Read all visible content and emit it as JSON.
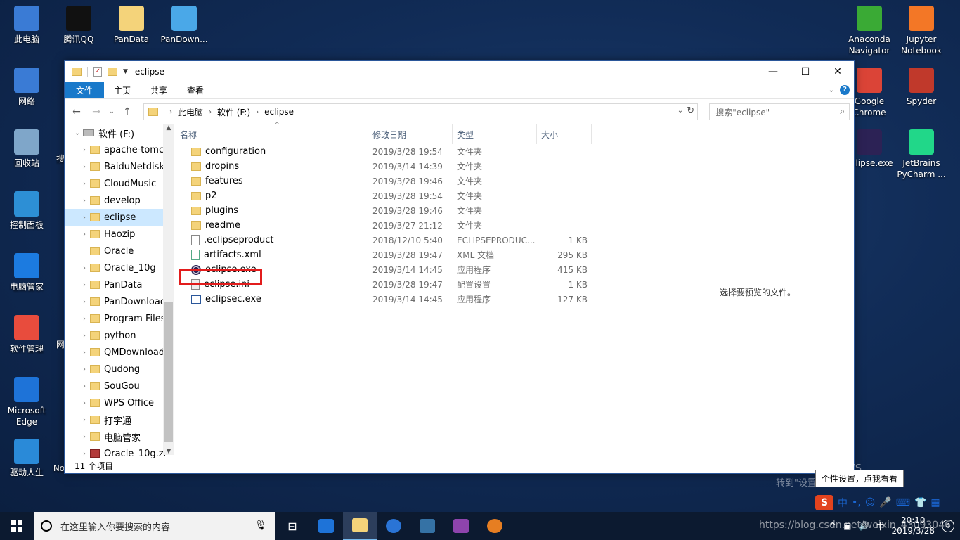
{
  "desktop": {
    "icons_left": [
      {
        "label": "此电脑",
        "icon": "computer-icon",
        "color": "#3a7bd5"
      },
      {
        "label": "网络",
        "icon": "network-icon",
        "color": "#3a7bd5"
      },
      {
        "label": "回收站",
        "icon": "recycle-bin-icon",
        "color": "#7fa6c9"
      },
      {
        "label": "控制面板",
        "icon": "control-panel-icon",
        "color": "#2d8fd5"
      },
      {
        "label": "电脑管家",
        "icon": "pc-manager-icon",
        "color": "#1c7be0"
      },
      {
        "label": "软件管理",
        "icon": "software-manager-icon",
        "color": "#e84c3d"
      },
      {
        "label": "Microsoft Edge",
        "icon": "edge-icon",
        "color": "#1e73d8"
      },
      {
        "label": "驱动人生",
        "icon": "driver-icon",
        "color": "#2a8ad8"
      }
    ],
    "icons_top": [
      {
        "label": "腾讯QQ",
        "icon": "qq-icon",
        "color": "#111111"
      },
      {
        "label": "PanData",
        "icon": "folder-icon",
        "color": "#f4d37a"
      },
      {
        "label": "PanDown...",
        "icon": "cloud-icon",
        "color": "#4aa8e8"
      }
    ],
    "icons_right": [
      {
        "label": "Anaconda Navigator",
        "icon": "anaconda-icon",
        "color": "#3aaa35"
      },
      {
        "label": "Jupyter Notebook",
        "icon": "jupyter-icon",
        "color": "#f37726"
      },
      {
        "label": "Google Chrome",
        "icon": "chrome-icon",
        "color": "#db4437"
      },
      {
        "label": "Spyder",
        "icon": "spyder-icon",
        "color": "#c0392b"
      },
      {
        "label": "eclipse.exe",
        "icon": "eclipse-icon",
        "color": "#2c2255"
      },
      {
        "label": "JetBrains PyCharm ...",
        "icon": "pycharm-icon",
        "color": "#21d789"
      }
    ],
    "partial_labels": [
      "搜",
      "网",
      "No"
    ]
  },
  "window": {
    "title": "eclipse",
    "ribbon_tabs": [
      "文件",
      "主页",
      "共享",
      "查看"
    ],
    "address": [
      "此电脑",
      "软件 (F:)",
      "eclipse"
    ],
    "search_placeholder": "搜索\"eclipse\"",
    "nav_drive": "软件 (F:)",
    "nav_items": [
      {
        "label": "apache-tomca",
        "exp": true
      },
      {
        "label": "BaiduNetdisk",
        "exp": true
      },
      {
        "label": "CloudMusic",
        "exp": true
      },
      {
        "label": "develop",
        "exp": true
      },
      {
        "label": "eclipse",
        "exp": true,
        "selected": true
      },
      {
        "label": "Haozip",
        "exp": true
      },
      {
        "label": "Oracle",
        "exp": false
      },
      {
        "label": "Oracle_10g",
        "exp": true
      },
      {
        "label": "PanData",
        "exp": true
      },
      {
        "label": "PanDownload",
        "exp": true
      },
      {
        "label": "Program Files",
        "exp": true
      },
      {
        "label": "python",
        "exp": true
      },
      {
        "label": "QMDownload",
        "exp": true
      },
      {
        "label": "Qudong",
        "exp": true
      },
      {
        "label": "SouGou",
        "exp": true
      },
      {
        "label": "WPS Office",
        "exp": true
      },
      {
        "label": "打字通",
        "exp": true
      },
      {
        "label": "电脑管家",
        "exp": true
      },
      {
        "label": "Oracle_10g.zi",
        "exp": true,
        "zip": true
      }
    ],
    "columns": [
      "名称",
      "修改日期",
      "类型",
      "大小"
    ],
    "files": [
      {
        "name": "configuration",
        "date": "2019/3/28 19:54",
        "type": "文件夹",
        "size": "",
        "icon": "folder"
      },
      {
        "name": "dropins",
        "date": "2019/3/14 14:39",
        "type": "文件夹",
        "size": "",
        "icon": "folder"
      },
      {
        "name": "features",
        "date": "2019/3/28 19:46",
        "type": "文件夹",
        "size": "",
        "icon": "folder"
      },
      {
        "name": "p2",
        "date": "2019/3/28 19:54",
        "type": "文件夹",
        "size": "",
        "icon": "folder"
      },
      {
        "name": "plugins",
        "date": "2019/3/28 19:46",
        "type": "文件夹",
        "size": "",
        "icon": "folder"
      },
      {
        "name": "readme",
        "date": "2019/3/27 21:12",
        "type": "文件夹",
        "size": "",
        "icon": "folder"
      },
      {
        "name": ".eclipseproduct",
        "date": "2018/12/10 5:40",
        "type": "ECLIPSEPRODUC...",
        "size": "1 KB",
        "icon": "doc"
      },
      {
        "name": "artifacts.xml",
        "date": "2019/3/28 19:47",
        "type": "XML 文档",
        "size": "295 KB",
        "icon": "xml"
      },
      {
        "name": "eclipse.exe",
        "date": "2019/3/14 14:45",
        "type": "应用程序",
        "size": "415 KB",
        "icon": "exe"
      },
      {
        "name": "eclipse.ini",
        "date": "2019/3/28 19:47",
        "type": "配置设置",
        "size": "1 KB",
        "icon": "ini"
      },
      {
        "name": "eclipsec.exe",
        "date": "2019/3/14 14:45",
        "type": "应用程序",
        "size": "127 KB",
        "icon": "app"
      }
    ],
    "preview_text": "选择要预览的文件。",
    "status": "11 个项目"
  },
  "overlay": {
    "watermark_line1": "激活 Windows",
    "watermark_line2": "转到\"设置\"以激活 Windows。",
    "tooltip": "个性设置，点我看看",
    "ime_label": "中"
  },
  "taskbar": {
    "search_placeholder": "在这里输入你要搜索的内容",
    "time": "20:10",
    "date": "2019/3/28",
    "notification_count": "4",
    "url_watermark": "https://blog.csdn.net/weixin_43093046"
  }
}
